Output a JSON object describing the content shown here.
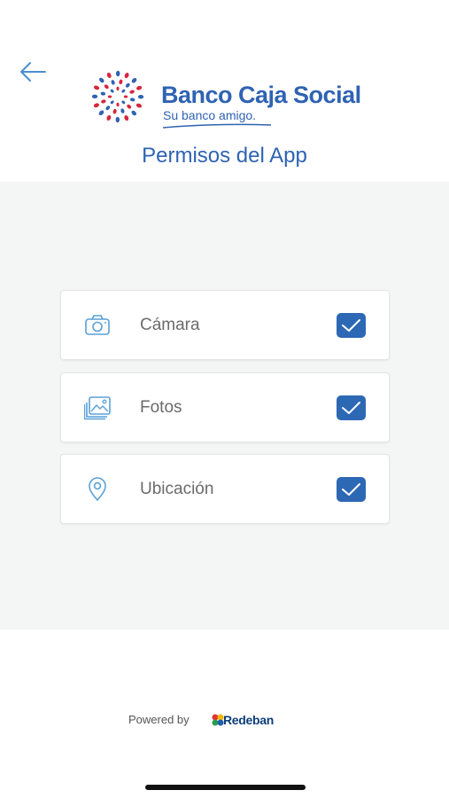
{
  "brand": {
    "name": "Banco Caja Social",
    "tagline": "Su banco amigo."
  },
  "page": {
    "title": "Permisos del App"
  },
  "permissions": [
    {
      "label": "Cámara",
      "icon": "camera-icon",
      "checked": true
    },
    {
      "label": "Fotos",
      "icon": "photos-icon",
      "checked": true
    },
    {
      "label": "Ubicación",
      "icon": "location-pin-icon",
      "checked": true
    }
  ],
  "footer": {
    "powered_by": "Powered by",
    "partner": "Redeban"
  },
  "colors": {
    "brand_blue": "#2f63b3",
    "checkbox_blue": "#2d68b5",
    "logo_red": "#d7263d",
    "background_gray": "#f4f5f5"
  }
}
